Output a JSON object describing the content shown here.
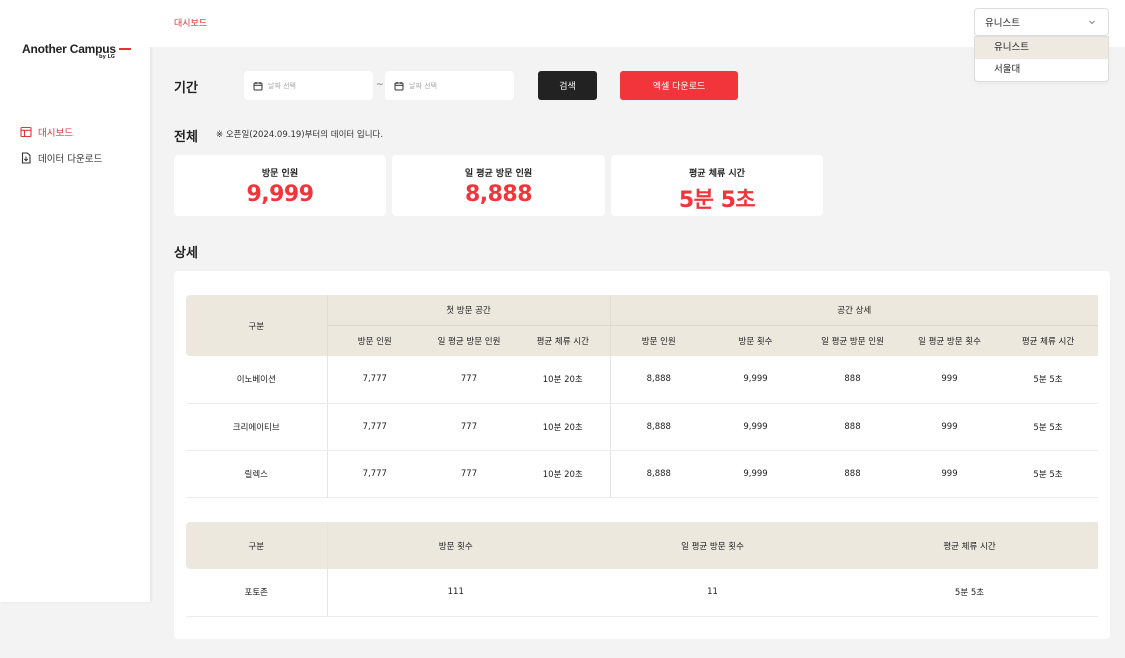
{
  "sidebar": {
    "logo": "Another Campus",
    "logo_sub": "by LG",
    "items": [
      {
        "label": "대시보드",
        "icon": "dashboard-icon",
        "active": true
      },
      {
        "label": "데이터 다운로드",
        "icon": "download-doc-icon",
        "active": false
      }
    ]
  },
  "header": {
    "breadcrumb": "대시보드",
    "select": {
      "value": "유니스트",
      "options": [
        "유니스트",
        "서울대"
      ],
      "highlighted": "유니스트"
    }
  },
  "filter": {
    "title": "기간",
    "start_placeholder": "날짜 선택",
    "end_placeholder": "날짜 선택",
    "separator": "~",
    "search_label": "검색",
    "excel_label": "엑셀 다운로드"
  },
  "overall": {
    "title": "전체",
    "note": "※ 오픈일(2024.09.19)부터의 데이터 입니다.",
    "cards": [
      {
        "label": "방문 인원",
        "value": "9,999"
      },
      {
        "label": "일 평균 방문 인원",
        "value": "8,888"
      },
      {
        "label": "평균 체류 시간",
        "value": "5분 5초"
      }
    ]
  },
  "detail": {
    "title": "상세",
    "table1": {
      "row_header": "구분",
      "group1": "첫 방문 공간",
      "group2": "공간 상세",
      "columns": [
        "방문 인원",
        "일 평균 방문 인원",
        "평균 체류 시간",
        "방문 인원",
        "방문 횟수",
        "일 평균 방문 인원",
        "일 평균 방문 횟수",
        "평균 체류 시간"
      ],
      "rows": [
        {
          "name": "이노베이션",
          "cells": [
            "7,777",
            "777",
            "10분 20초",
            "8,888",
            "9,999",
            "888",
            "999",
            "5분 5초"
          ]
        },
        {
          "name": "크리에이티브",
          "cells": [
            "7,777",
            "777",
            "10분 20초",
            "8,888",
            "9,999",
            "888",
            "999",
            "5분 5초"
          ]
        },
        {
          "name": "릴렉스",
          "cells": [
            "7,777",
            "777",
            "10분 20초",
            "8,888",
            "9,999",
            "888",
            "999",
            "5분 5초"
          ]
        }
      ]
    },
    "table2": {
      "row_header": "구분",
      "columns": [
        "방문 횟수",
        "일 평균 방문 횟수",
        "평균 체류 시간"
      ],
      "rows": [
        {
          "name": "포토존",
          "cells": [
            "111",
            "11",
            "5분 5초"
          ]
        }
      ]
    }
  },
  "colors": {
    "accent": "#f2353a",
    "table_header": "#ede8de",
    "dark_button": "#222222"
  }
}
